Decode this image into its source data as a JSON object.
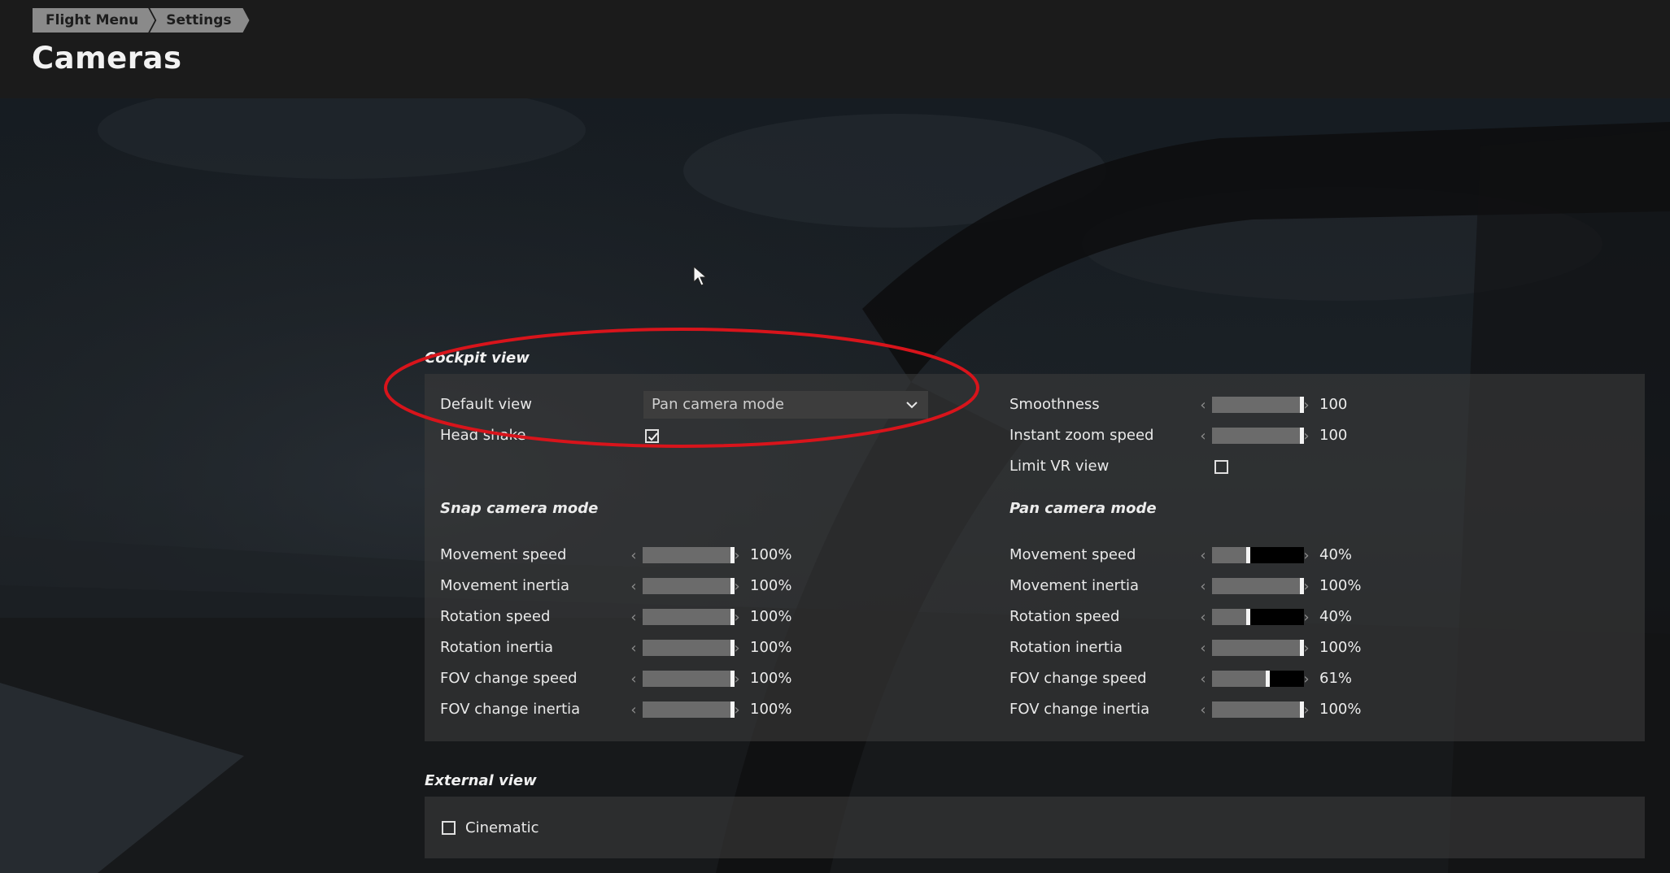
{
  "breadcrumb": [
    "Flight Menu",
    "Settings"
  ],
  "page_title": "Cameras",
  "cockpit_view": {
    "title": "Cockpit view",
    "default_view": {
      "label": "Default view",
      "value": "Pan camera mode"
    },
    "head_shake": {
      "label": "Head shake",
      "checked": true
    },
    "smoothness": {
      "label": "Smoothness",
      "value": "100",
      "level": 1.0
    },
    "instant_zoom_speed": {
      "label": "Instant zoom speed",
      "value": "100",
      "level": 1.0
    },
    "limit_vr_view": {
      "label": "Limit VR view",
      "checked": false
    },
    "snap_camera_mode": {
      "title": "Snap camera mode",
      "settings": [
        {
          "label": "Movement speed",
          "value": "100%",
          "level": 1.0
        },
        {
          "label": "Movement inertia",
          "value": "100%",
          "level": 1.0
        },
        {
          "label": "Rotation speed",
          "value": "100%",
          "level": 1.0
        },
        {
          "label": "Rotation inertia",
          "value": "100%",
          "level": 1.0
        },
        {
          "label": "FOV change speed",
          "value": "100%",
          "level": 1.0
        },
        {
          "label": "FOV change inertia",
          "value": "100%",
          "level": 1.0
        }
      ]
    },
    "pan_camera_mode": {
      "title": "Pan camera mode",
      "settings": [
        {
          "label": "Movement speed",
          "value": "40%",
          "level": 0.4
        },
        {
          "label": "Movement inertia",
          "value": "100%",
          "level": 1.0
        },
        {
          "label": "Rotation speed",
          "value": "40%",
          "level": 0.4
        },
        {
          "label": "Rotation inertia",
          "value": "100%",
          "level": 1.0
        },
        {
          "label": "FOV change speed",
          "value": "61%",
          "level": 0.61
        },
        {
          "label": "FOV change inertia",
          "value": "100%",
          "level": 1.0
        }
      ]
    }
  },
  "external_view": {
    "title": "External view",
    "cinematic": {
      "label": "Cinematic",
      "checked": false
    }
  },
  "icons": {
    "slider_left": "chevron-left-icon",
    "slider_right": "chevron-right-icon",
    "dropdown": "chevron-down-icon",
    "checkmark": "checkmark-icon"
  },
  "colors": {
    "annotation": "#d8141b",
    "panel": "#3a3a3a",
    "slider_fill": "#6b6b6b"
  }
}
